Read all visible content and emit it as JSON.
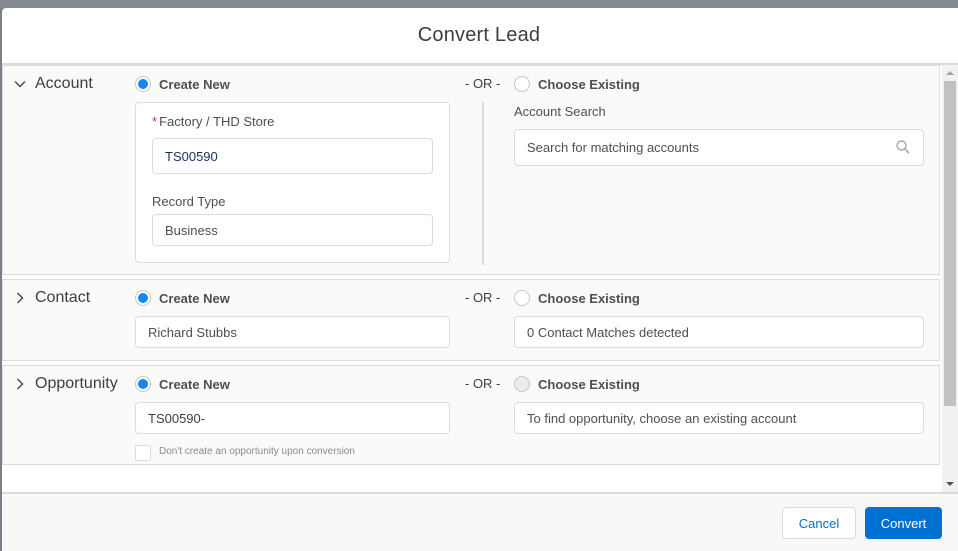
{
  "modal": {
    "title": "Convert Lead"
  },
  "sections": {
    "account": {
      "title": "Account",
      "expanded": true,
      "create_new_label": "Create New",
      "create_new_selected": true,
      "or_label": "- OR -",
      "choose_existing_label": "Choose Existing",
      "choose_existing_selected": false,
      "factory_label": "Factory / THD Store",
      "factory_required_mark": "*",
      "factory_value": "TS00590",
      "record_type_label": "Record Type",
      "record_type_value": "Business",
      "account_search_label": "Account Search",
      "account_search_placeholder": "Search for matching accounts",
      "search_icon": "search-icon"
    },
    "contact": {
      "title": "Contact",
      "expanded": false,
      "create_new_label": "Create New",
      "create_new_selected": true,
      "or_label": "- OR -",
      "choose_existing_label": "Choose Existing",
      "choose_existing_selected": false,
      "name_value": "Richard Stubbs",
      "matches_text": "0 Contact Matches detected"
    },
    "opportunity": {
      "title": "Opportunity",
      "expanded": false,
      "create_new_label": "Create New",
      "create_new_selected": true,
      "or_label": "- OR -",
      "choose_existing_label": "Choose Existing",
      "choose_existing_selected": false,
      "choose_existing_disabled": true,
      "name_value": "TS00590-",
      "existing_hint": "To find opportunity, choose an existing account",
      "dont_create_label": "Don't create an opportunity upon conversion",
      "dont_create_checked": false
    }
  },
  "footer": {
    "cancel_label": "Cancel",
    "convert_label": "Convert"
  },
  "colors": {
    "brand": "#0070d2",
    "radio_selected": "#1589ee",
    "required": "#c23934"
  }
}
